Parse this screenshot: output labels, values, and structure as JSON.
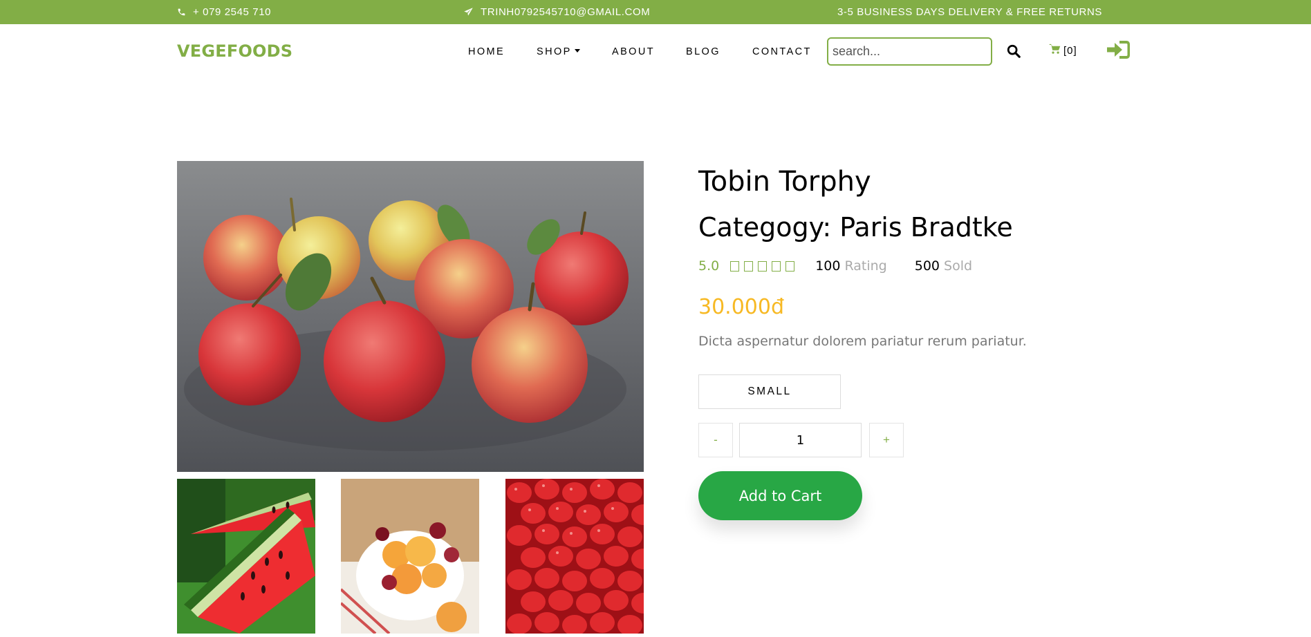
{
  "topbar": {
    "phone": "+ 079 2545 710",
    "email": "TRINH0792545710@GMAIL.COM",
    "shipping": "3-5 BUSINESS DAYS DELIVERY & FREE RETURNS"
  },
  "brand": {
    "name": "VEGEFOODS",
    "color": "#82ae46"
  },
  "nav": {
    "home": "HOME",
    "shop": "SHOP",
    "about": "ABOUT",
    "blog": "BLOG",
    "contact": "CONTACT"
  },
  "search": {
    "placeholder": "search...",
    "value": ""
  },
  "cart": {
    "count_label": "[0]"
  },
  "icons": {
    "phone": "phone-icon",
    "email": "paper-plane-icon",
    "search": "search-icon",
    "cart": "cart-icon",
    "login": "sign-in-icon"
  },
  "product": {
    "name": "Tobin Torphy",
    "category_label": "Categogy: Paris Bradtke",
    "rating_score": "5.0",
    "stars": 5,
    "rating_count": "100",
    "rating_word": "Rating",
    "sold_count": "500",
    "sold_word": "Sold",
    "price": "30.000đ",
    "description": "Dicta aspernatur dolorem pariatur rerum pariatur.",
    "size": "SMALL",
    "quantity": "1",
    "minus_label": "-",
    "plus_label": "+",
    "add_to_cart": "Add to Cart",
    "images": {
      "main": "apples",
      "thumbnails": [
        "watermelon",
        "peaches-and-cherries",
        "strawberries"
      ]
    }
  },
  "colors": {
    "accent": "#82ae46",
    "price": "#f7b924",
    "button": "#28a745"
  }
}
